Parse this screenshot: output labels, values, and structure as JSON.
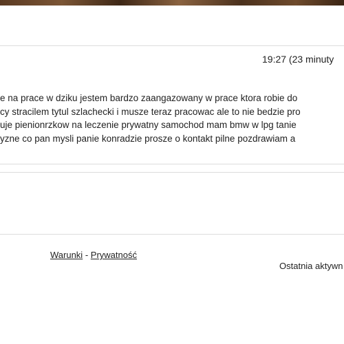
{
  "post": {
    "timestamp": "19:27 (23 minuty",
    "lines": [
      "e na prace w dziku jestem bardzo zaangazowany w prace ktora robie do",
      "cy stracilem tytul szlachecki i musze teraz pracowac ale to nie bedzie pro",
      "uje pienionrzkow na leczenie prywatny samochod mam bmw w lpg tanie",
      "yzne co pan mysli panie konradzie prosze o kontakt pilne pozdrawiam a"
    ]
  },
  "footer": {
    "terms_label": "Warunki",
    "separator": "-",
    "privacy_label": "Prywatność",
    "last_active": "Ostatnia aktywn"
  }
}
